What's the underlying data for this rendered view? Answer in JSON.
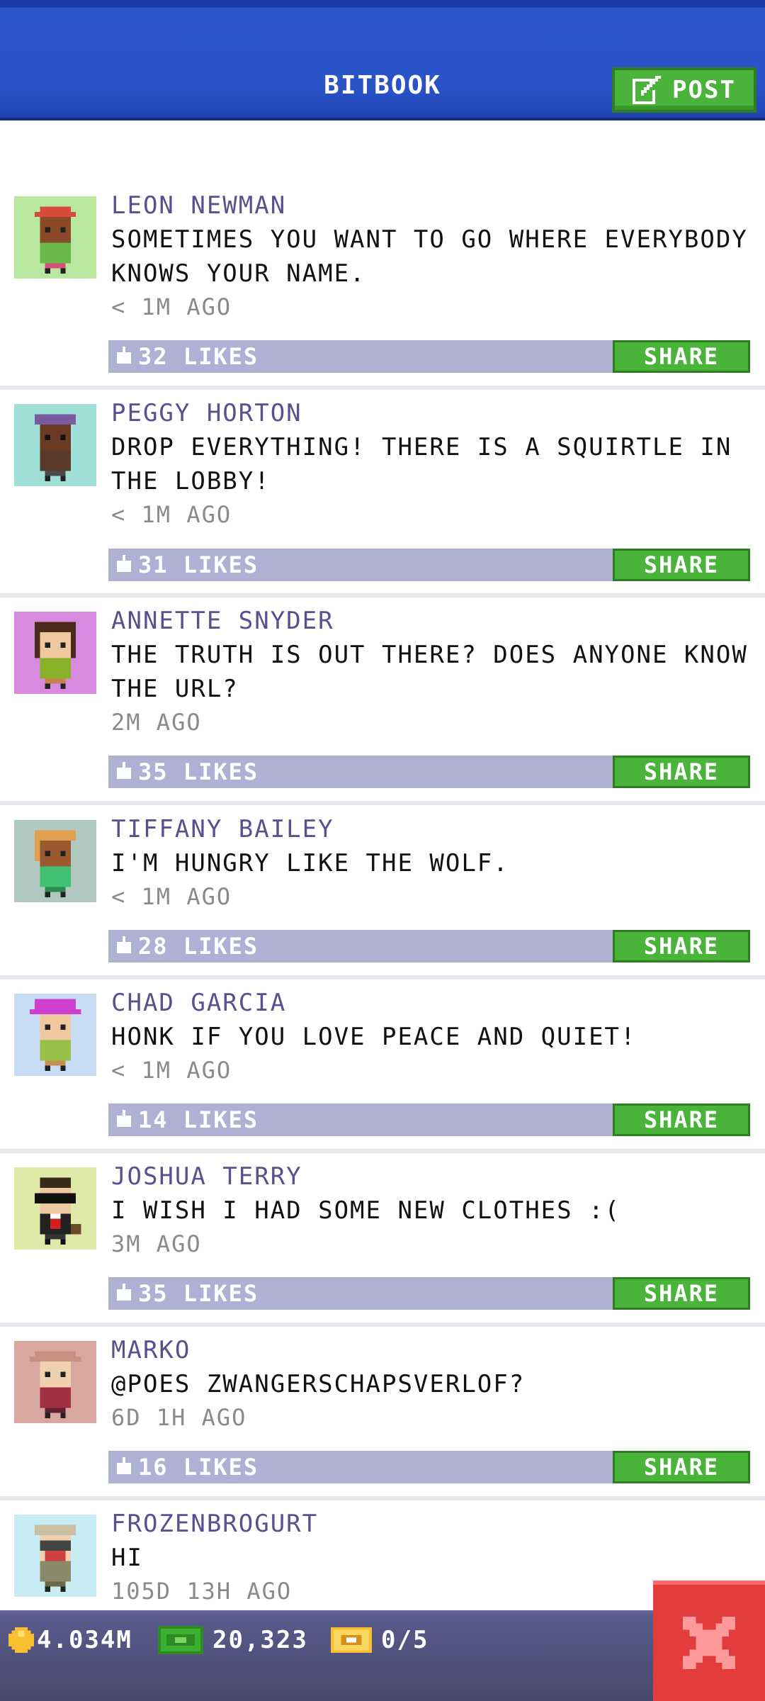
{
  "header": {
    "title": "BITBOOK",
    "post_label": "POST"
  },
  "posts": [
    {
      "author": "LEON NEWMAN",
      "message": "SOMETIMES YOU WANT TO GO WHERE EVERYBODY KNOWS YOUR NAME.",
      "time": "< 1M AGO",
      "likes": "32 LIKES",
      "share": "SHARE"
    },
    {
      "author": "PEGGY HORTON",
      "message": "DROP EVERYTHING! THERE IS A SQUIRTLE IN THE LOBBY!",
      "time": "< 1M AGO",
      "likes": "31 LIKES",
      "share": "SHARE"
    },
    {
      "author": "ANNETTE SNYDER",
      "message": "THE TRUTH IS OUT THERE? DOES ANYONE KNOW THE URL?",
      "time": "2M AGO",
      "likes": "35 LIKES",
      "share": "SHARE"
    },
    {
      "author": "TIFFANY BAILEY",
      "message": "I'M HUNGRY LIKE THE WOLF.",
      "time": "< 1M AGO",
      "likes": "28 LIKES",
      "share": "SHARE"
    },
    {
      "author": "CHAD GARCIA",
      "message": "HONK IF YOU LOVE PEACE AND QUIET!",
      "time": "< 1M AGO",
      "likes": "14 LIKES",
      "share": "SHARE"
    },
    {
      "author": "JOSHUA TERRY",
      "message": "I WISH I HAD SOME NEW CLOTHES :(",
      "time": "3M AGO",
      "likes": "35 LIKES",
      "share": "SHARE"
    },
    {
      "author": "MARKO",
      "message": "@POES ZWANGERSCHAPSVERLOF?",
      "time": "6D 1H AGO",
      "likes": "16 LIKES",
      "share": "SHARE"
    },
    {
      "author": "FROZENBROGURT",
      "message": "HI",
      "time": "105D 13H AGO"
    }
  ],
  "status_bar": {
    "coins": "4.034M",
    "bux": "20,323",
    "tickets": "0/5"
  },
  "colors": {
    "header_blue": "#2a53c8",
    "button_green": "#49b33a",
    "likes_bar": "#b0b0d4",
    "author_purple": "#5a4f8f",
    "close_red": "#e23c3c"
  },
  "icons": {
    "post": "edit-icon",
    "like": "thumbs-up-icon",
    "coin": "coin-icon",
    "bux": "bux-icon",
    "ticket": "ticket-icon",
    "close": "close-icon"
  }
}
